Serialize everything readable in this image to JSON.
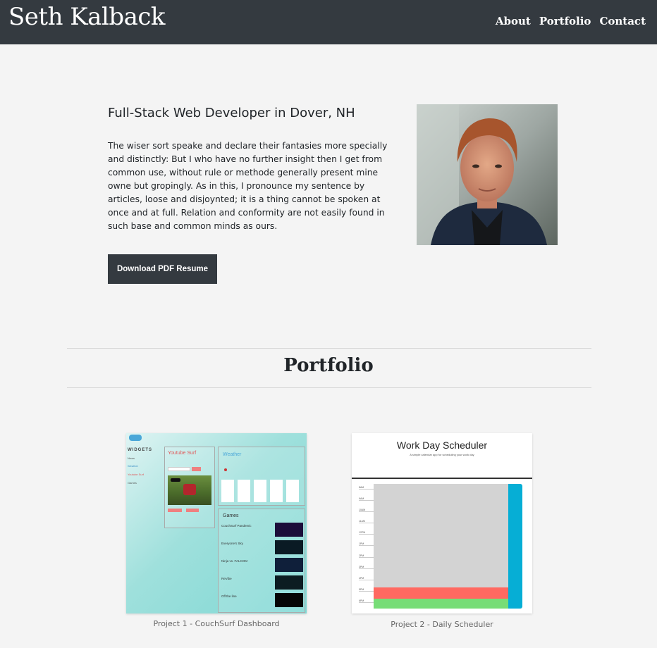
{
  "nav": {
    "brand": "Seth Kalback",
    "links": [
      "About",
      "Portfolio",
      "Contact"
    ]
  },
  "intro": {
    "heading": "Full-Stack Web Developer in Dover, NH",
    "paragraph": "The wiser sort speake and declare their fantasies more specially and distinctly: But I who have no further insight then I get from common use, without rule or methode generally present mine owne but gropingly. As in this, I pronounce my sentence by articles, loose and disjoynted; it is a thing cannot be spoken at once and at full. Relation and conformity are not easily found in such base and common minds as ours.",
    "resume_button": "Download PDF Resume"
  },
  "portfolio": {
    "title": "Portfolio",
    "projects": [
      {
        "caption": "Project 1 - CouchSurf Dashboard",
        "thumb": {
          "sidebar_title": "WIDGETS",
          "sidebar_items": [
            "News",
            "Weather",
            "Youtube Surf",
            "Games"
          ],
          "youtube_title": "Youtube Surf",
          "weather_title": "Weather",
          "games_title": "Games",
          "games": [
            "CouchSurf Pandemic",
            "Everyone's Sky",
            "Ninja vs. FALCOM",
            "ReVibe",
            "Off the line"
          ]
        }
      },
      {
        "caption": "Project 2 - Daily Scheduler",
        "thumb": {
          "title": "Work Day Scheduler",
          "subtitle": "A simple calendar app for scheduling your work day",
          "hours": [
            "8AM",
            "9AM",
            "10AM",
            "11AM",
            "12PM",
            "1PM",
            "2PM",
            "3PM",
            "4PM",
            "5PM",
            "6PM"
          ]
        }
      }
    ]
  },
  "colors": {
    "navbar": "#343a40",
    "background": "#f4f4f4",
    "schedule_past": "#d3d3d3",
    "schedule_present": "#ff6961",
    "schedule_future": "#77dd77",
    "schedule_save": "#06aed5",
    "dashboard_teal": "#7fd8d4"
  }
}
